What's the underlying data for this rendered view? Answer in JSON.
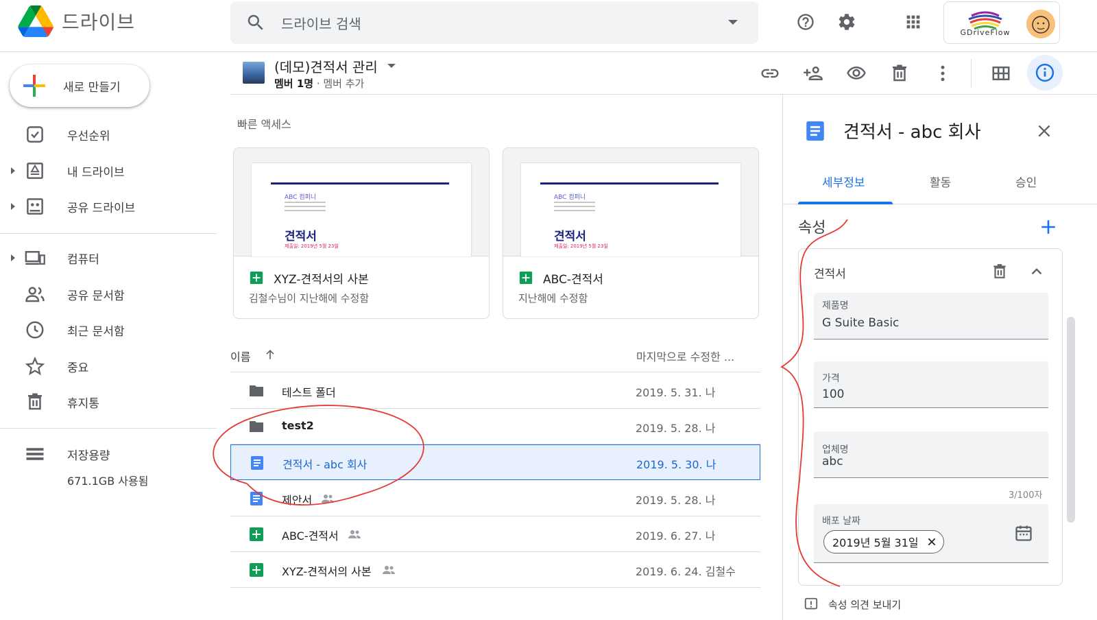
{
  "header": {
    "app_name": "드라이브",
    "search_placeholder": "드라이브 검색",
    "account_brand": "GDriveFlow"
  },
  "sidebar": {
    "new_button": "새로 만들기",
    "items": [
      {
        "label": "우선순위",
        "icon": "priority-icon"
      },
      {
        "label": "내 드라이브",
        "icon": "my-drive-icon"
      },
      {
        "label": "공유 드라이브",
        "icon": "shared-drives-icon"
      },
      {
        "label": "컴퓨터",
        "icon": "computer-icon"
      },
      {
        "label": "공유 문서함",
        "icon": "shared-with-me-icon"
      },
      {
        "label": "최근 문서함",
        "icon": "recent-icon"
      },
      {
        "label": "중요",
        "icon": "star-icon"
      },
      {
        "label": "휴지통",
        "icon": "trash-icon"
      }
    ],
    "storage": {
      "label": "저장용량",
      "used": "671.1GB 사용됨"
    }
  },
  "team": {
    "title": "(데모)견적서 관리",
    "members": "멤버 1명",
    "add_member": "멤버 추가"
  },
  "quick_access": {
    "label": "빠른 액세스",
    "cards": [
      {
        "name": "XYZ-견적서의 사본",
        "sub": "김철수님이 지난해에 수정함",
        "thumb_company": "ABC 컴퍼니",
        "thumb_heading": "견적서",
        "thumb_date": "제출일: 2019년 5월 23일"
      },
      {
        "name": "ABC-견적서",
        "sub": "지난해에 수정함",
        "thumb_company": "ABC 컴퍼니",
        "thumb_heading": "견적서",
        "thumb_date": "제출일: 2019년 5월 23일"
      }
    ]
  },
  "file_list": {
    "col_name": "이름",
    "col_modified": "마지막으로 수정한 ...",
    "rows": [
      {
        "name": "테스트 폴더",
        "type": "folder",
        "shared": false,
        "modified": "2019. 5. 31. 나"
      },
      {
        "name": "test2",
        "type": "folder",
        "shared": false,
        "modified": "2019. 5. 28. 나"
      },
      {
        "name": "견적서 - abc 회사",
        "type": "doc",
        "shared": false,
        "modified": "2019. 5. 30. 나",
        "selected": true
      },
      {
        "name": "제안서",
        "type": "doc",
        "shared": true,
        "modified": "2019. 5. 28. 나"
      },
      {
        "name": "ABC-견적서",
        "type": "sheet",
        "shared": true,
        "modified": "2019. 6. 27. 나"
      },
      {
        "name": "XYZ-견적서의 사본",
        "type": "sheet",
        "shared": true,
        "modified": "2019. 6. 24. 김철수"
      }
    ]
  },
  "panel": {
    "title": "견적서 - abc 회사",
    "tabs": [
      "세부정보",
      "활동",
      "승인"
    ],
    "active_tab": "세부정보",
    "section": "속성",
    "property_group": "견적서",
    "fields": [
      {
        "label": "제품명",
        "value": "G Suite Basic"
      },
      {
        "label": "가격",
        "value": "100"
      },
      {
        "label": "업체명",
        "value": "abc"
      }
    ],
    "counter": "3/100자",
    "date_field": {
      "label": "배포 날짜",
      "chip": "2019년 5월 31일"
    },
    "footer": "속성 의견 보내기"
  },
  "colors": {
    "accent": "#1a73e8",
    "selected_bg": "#e8f0fe",
    "annotation": "#e53935"
  }
}
